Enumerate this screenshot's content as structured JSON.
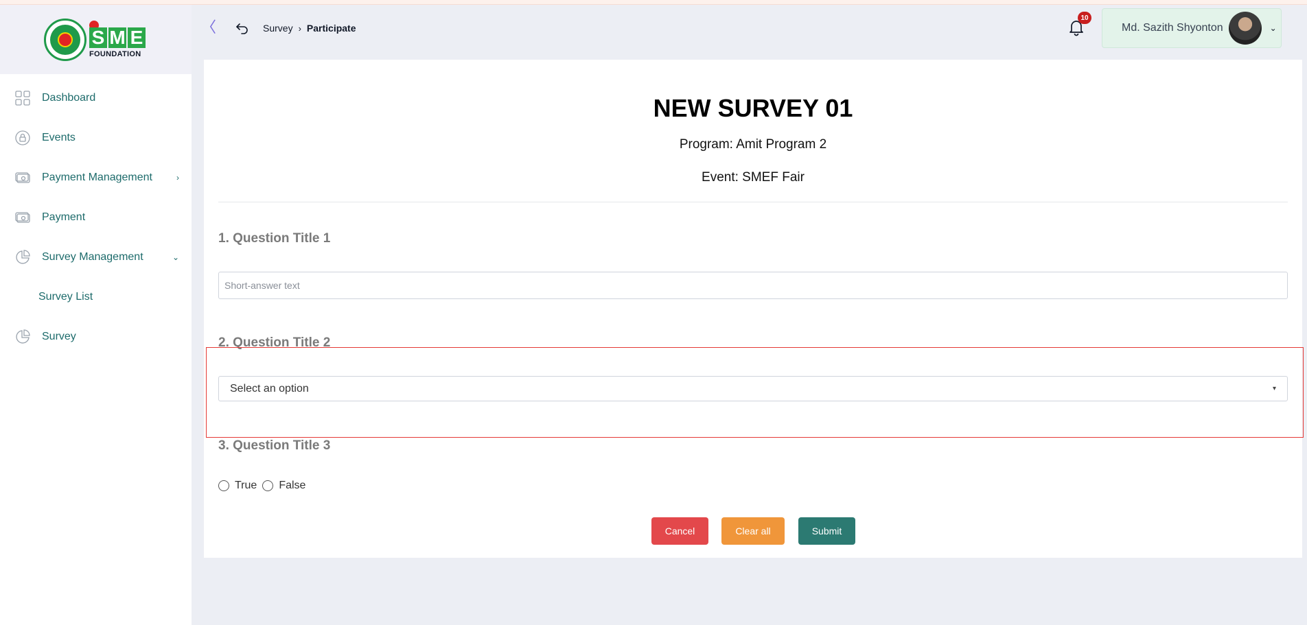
{
  "brand": {
    "letters": [
      "S",
      "M",
      "E"
    ],
    "subtitle": "FOUNDATION"
  },
  "sidebar": {
    "items": [
      {
        "label": "Dashboard",
        "icon": "grid-icon"
      },
      {
        "label": "Events",
        "icon": "lock-circle-icon"
      },
      {
        "label": "Payment Management",
        "icon": "cash-icon",
        "chevron": "›"
      },
      {
        "label": "Payment",
        "icon": "cash-icon"
      },
      {
        "label": "Survey Management",
        "icon": "pie-chart-icon",
        "chevron": "⌄"
      },
      {
        "label": "Survey List"
      },
      {
        "label": "Survey",
        "icon": "pie-chart-icon"
      }
    ]
  },
  "header": {
    "collapse_glyph": "〈",
    "breadcrumb": {
      "parent": "Survey",
      "separator": "›",
      "current": "Participate"
    },
    "notifications": {
      "count": "10"
    },
    "user": {
      "name": "Md. Sazith Shyonton",
      "chevron": "⌄"
    }
  },
  "survey": {
    "title": "NEW SURVEY 01",
    "program": "Program: Amit Program 2",
    "event": "Event: SMEF Fair",
    "questions": [
      {
        "title": "1. Question Title 1",
        "placeholder": "Short-answer text"
      },
      {
        "title": "2. Question Title 2",
        "selected": "Select an option",
        "chevron": "▾"
      },
      {
        "title": "3. Question Title 3",
        "options": [
          "True",
          "False"
        ]
      }
    ],
    "actions": {
      "cancel": "Cancel",
      "clear": "Clear all",
      "submit": "Submit"
    }
  },
  "colors": {
    "primary_teal": "#2c7a72",
    "cancel_red": "#e3484b",
    "clear_orange": "#f0963a",
    "nav_text": "#1d6b6b",
    "highlight_red": "#e53935"
  }
}
